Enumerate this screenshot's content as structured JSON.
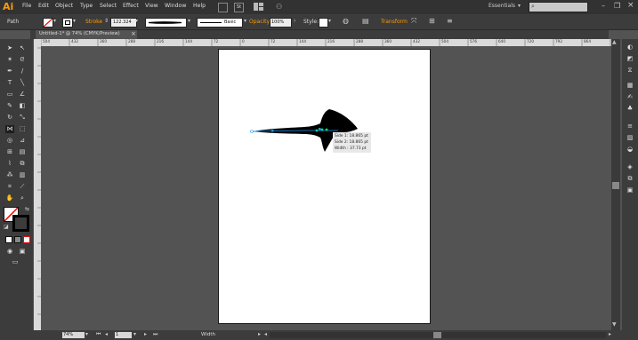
{
  "app": {
    "logo": "Ai",
    "workspace": "Essentials",
    "search_placeholder": ""
  },
  "menu": [
    "File",
    "Edit",
    "Object",
    "Type",
    "Select",
    "Effect",
    "View",
    "Window",
    "Help"
  ],
  "control_bar": {
    "selection_label": "Path",
    "stroke_label": "Stroke",
    "stroke_value": "122.324",
    "profile_label": "Basic",
    "opacity_label": "Opacity:",
    "opacity_value": "100%",
    "style_label": "Style:",
    "transform_label": "Transform"
  },
  "document_tab": {
    "title": "Untitled-1* @ 74% (CMYK/Preview)",
    "close": "×"
  },
  "ruler": {
    "ticks": [
      "504",
      "432",
      "360",
      "288",
      "216",
      "144",
      "72",
      "0",
      "72",
      "144",
      "216",
      "288",
      "360",
      "432",
      "504",
      "576",
      "640",
      "720",
      "792",
      "864",
      "936",
      "1008"
    ]
  },
  "tooltip": {
    "side1": "Side 1: 18.865 pt",
    "side2": "Side 2: 18.865 pt",
    "width": "Width : 37.73 pt"
  },
  "status": {
    "zoom": "74%",
    "page": "1",
    "tool": "Width"
  },
  "colors": {
    "accent": "#ff9a00",
    "path_highlight": "#2196f3",
    "anchor": "#00e676"
  }
}
